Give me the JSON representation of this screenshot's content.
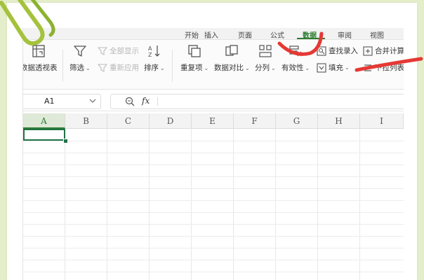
{
  "tabs": [
    "开始",
    "插入",
    "页面",
    "公式",
    "数据",
    "审阅",
    "视图"
  ],
  "active_tab": "数据",
  "ribbon": {
    "pivot_label": "数据透视表",
    "filter_label": "筛选",
    "show_all_label": "全部显示",
    "reapply_label": "重新应用",
    "sort_label": "排序",
    "duplicates_label": "重复项",
    "compare_label": "数据对比",
    "split_label": "分列",
    "validity_label": "有效性",
    "find_entry_label": "查找录入",
    "fill_label": "填充",
    "consolidate_label": "合并计算",
    "dropdown_label": "下拉列表"
  },
  "formula_bar": {
    "name_box": "A1",
    "fx_label": "fx",
    "formula_value": ""
  },
  "columns": [
    "A",
    "B",
    "C",
    "D",
    "E",
    "F",
    "G",
    "H",
    "I"
  ],
  "selected_cell": "A1",
  "colors": {
    "accent_green": "#217346",
    "annotation_red": "#e53935",
    "background": "#e4eecb"
  }
}
